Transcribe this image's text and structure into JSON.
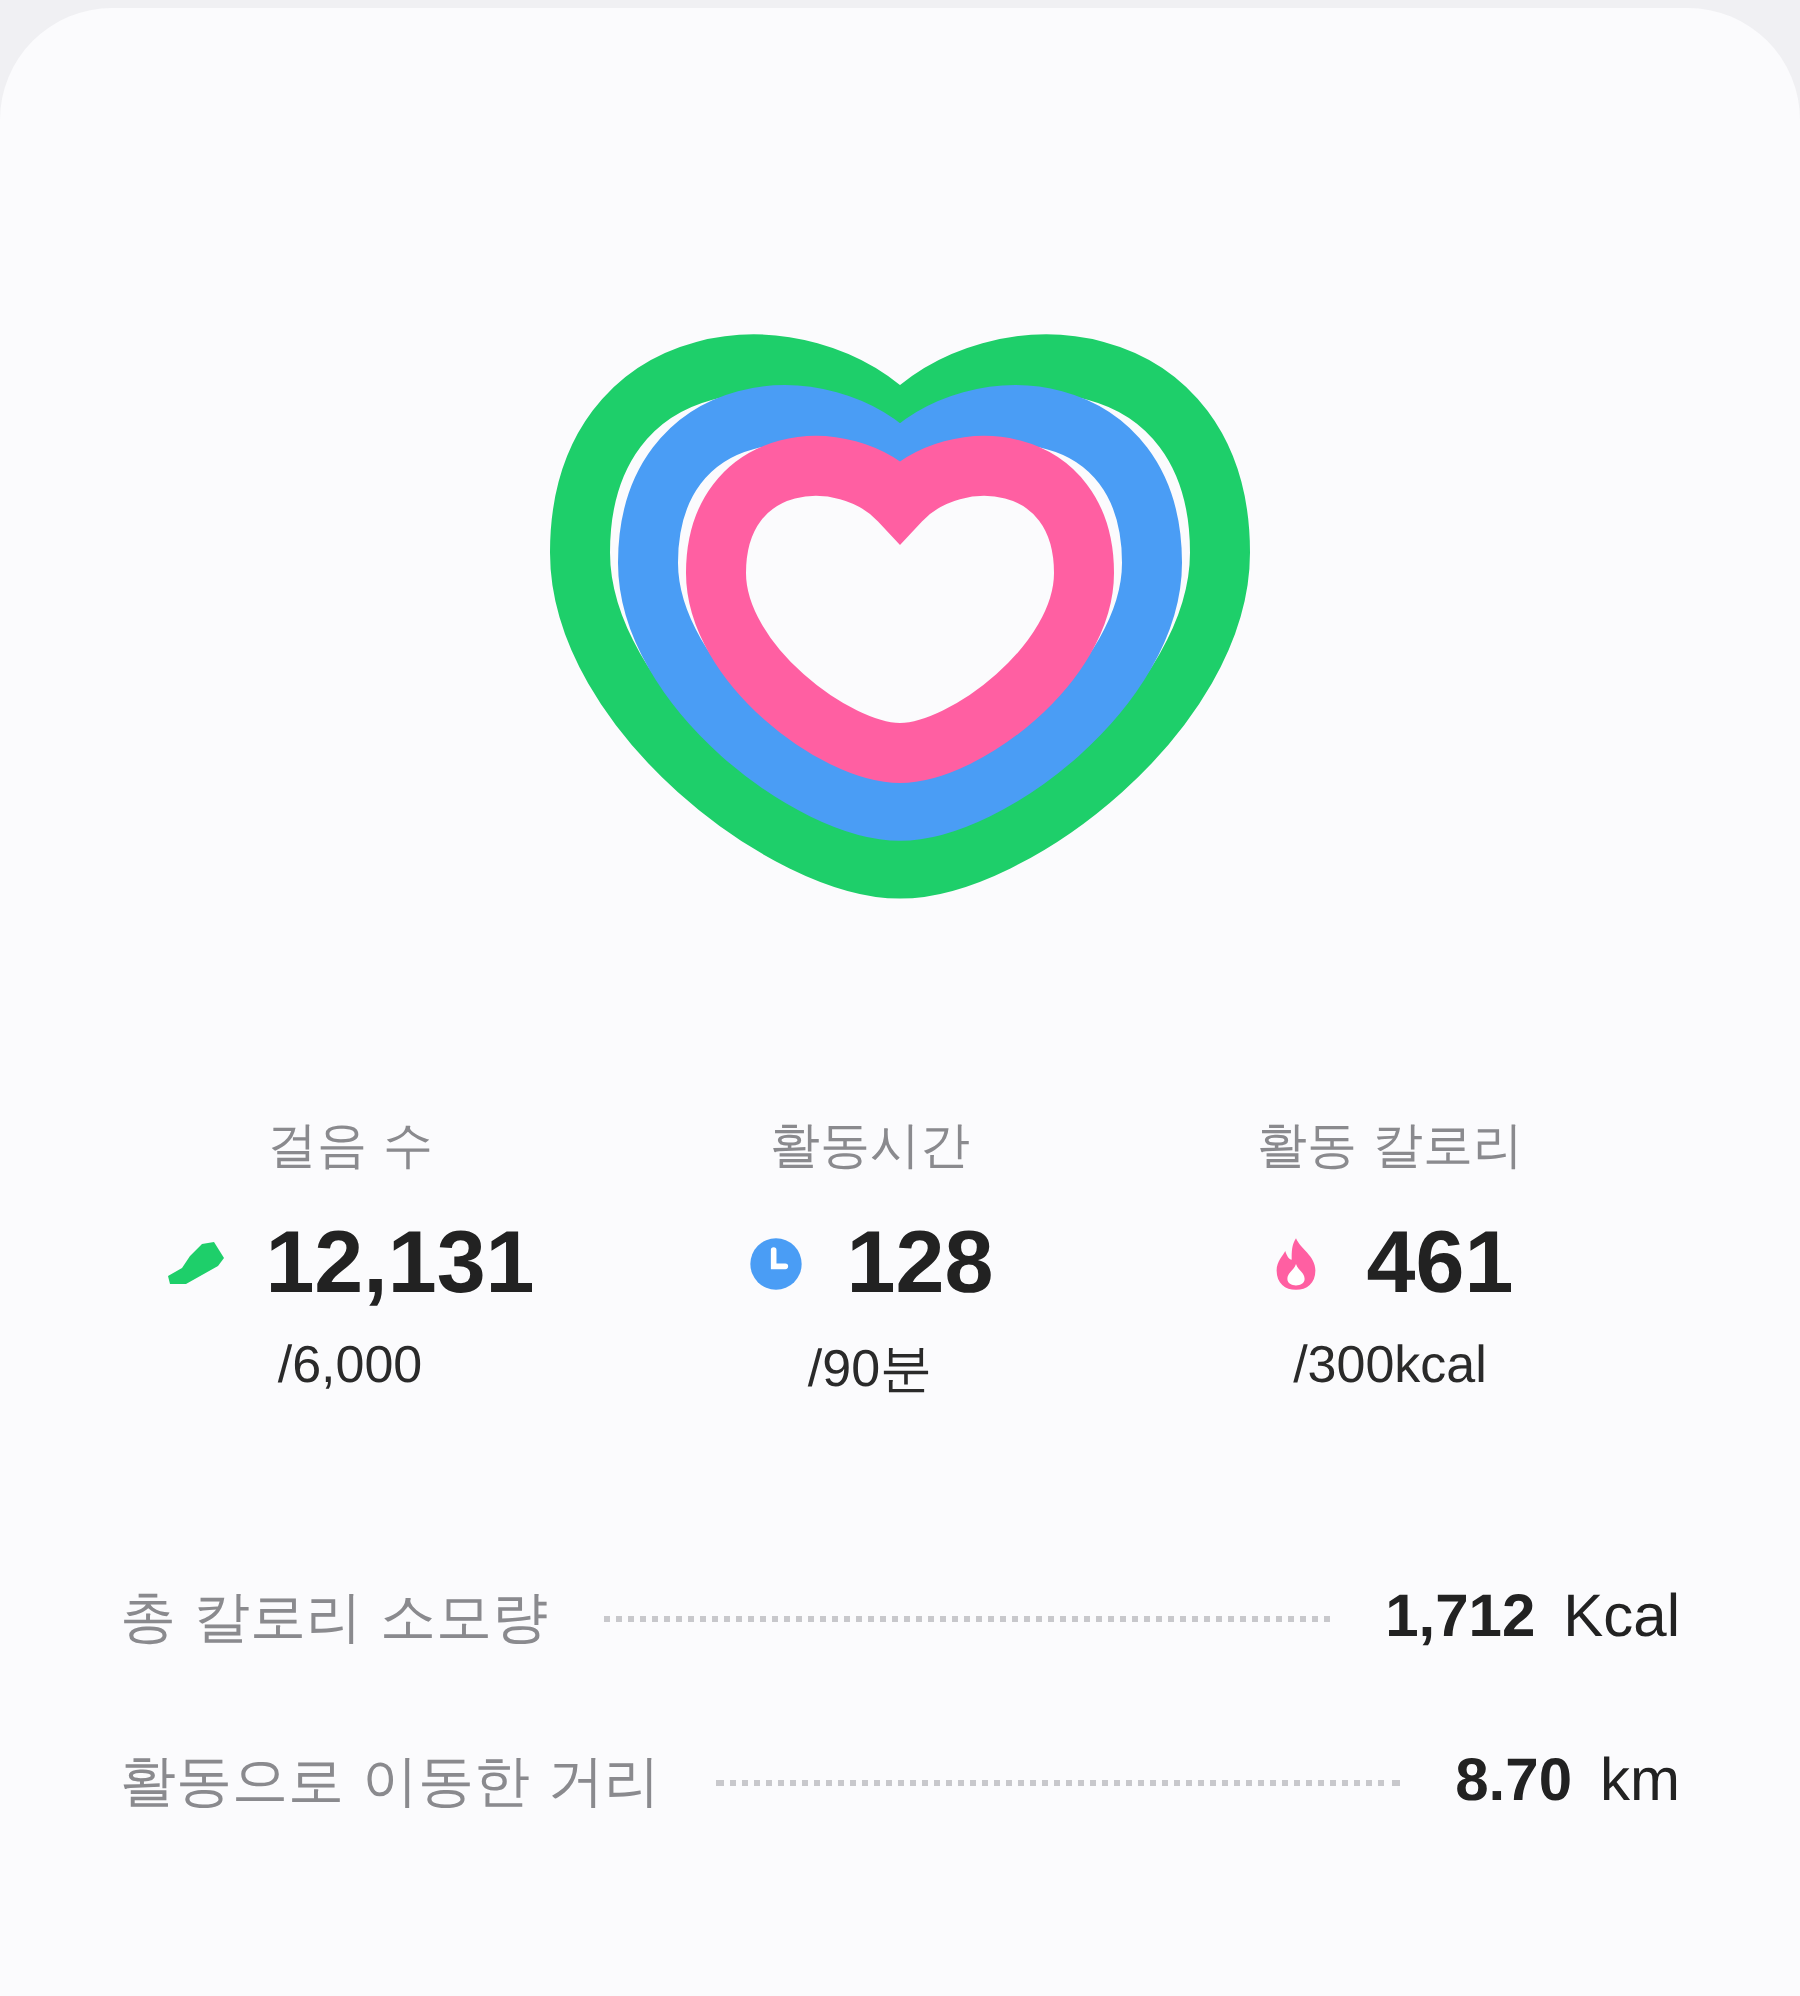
{
  "metrics": [
    {
      "kind": "steps",
      "label": "걸음 수",
      "value": "12,131",
      "goal": "/6,000",
      "color": "#1ecf6a"
    },
    {
      "kind": "time",
      "label": "활동시간",
      "value": "128",
      "goal": "/90분",
      "color": "#4a9df5"
    },
    {
      "kind": "calories",
      "label": "활동 칼로리",
      "value": "461",
      "goal": "/300kcal",
      "color": "#ff5fa2"
    }
  ],
  "details": [
    {
      "label": "총 칼로리 소모량",
      "value": "1,712",
      "unit": "Kcal"
    },
    {
      "label": "활동으로 이동한 거리",
      "value": "8.70",
      "unit": "km"
    }
  ]
}
